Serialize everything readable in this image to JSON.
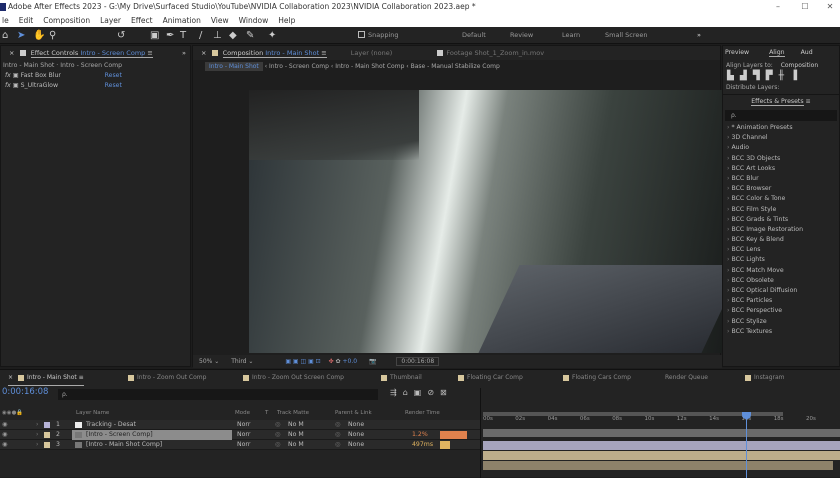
{
  "window": {
    "title": "Adobe After Effects 2023 - G:\\My Drive\\Surfaced Studio\\YouTube\\NVIDIA Collaboration 2023\\NVIDIA Collaboration 2023.aep *",
    "minimize": "–",
    "maximize": "☐",
    "close": "✕"
  },
  "menu": [
    "le",
    "Edit",
    "Composition",
    "Layer",
    "Effect",
    "Animation",
    "View",
    "Window",
    "Help"
  ],
  "toolbar": {
    "snapping": "Snapping",
    "workspaces": [
      "Default",
      "Review",
      "Learn",
      "Small Screen"
    ],
    "more": "»"
  },
  "effect_controls": {
    "title": "Effect Controls",
    "comp": "Intro - Screen Comp",
    "path": "Intro - Main Shot · Intro - Screen Comp",
    "effects": [
      {
        "name": "Fast Box Blur",
        "reset": "Reset"
      },
      {
        "name": "S_UltraGlow",
        "reset": "Reset"
      }
    ]
  },
  "composition": {
    "title": "Composition",
    "comp": "Intro - Main Shot",
    "layer": "Layer  (none)",
    "footage": "Footage  Shot_1_Zoom_in.mov",
    "breadcrumbs": [
      "Intro - Main Shot",
      "Intro - Screen Comp",
      "Intro - Main Shot Comp",
      "Base - Manual Stabilize Comp"
    ],
    "zoom": "50%",
    "resolution": "Third",
    "exposure": "+0.0",
    "timecode": "0:00:16:08"
  },
  "right_panel": {
    "tabs": [
      "Preview",
      "Align",
      "Aud"
    ],
    "align_label": "Align Layers to:",
    "align_value": "Composition",
    "distribute": "Distribute Layers:",
    "effects_title": "Effects & Presets",
    "search_placeholder": "ρ.",
    "presets": [
      "* Animation Presets",
      "3D Channel",
      "Audio",
      "BCC 3D Objects",
      "BCC Art Looks",
      "BCC Blur",
      "BCC Browser",
      "BCC Color & Tone",
      "BCC Film Style",
      "BCC Grads & Tints",
      "BCC Image Restoration",
      "BCC Key & Blend",
      "BCC Lens",
      "BCC Lights",
      "BCC Match Move",
      "BCC Obsolete",
      "BCC Optical Diffusion",
      "BCC Particles",
      "BCC Perspective",
      "BCC Stylize",
      "BCC Textures"
    ]
  },
  "timeline": {
    "tabs": [
      "Intro - Main Shot",
      "Intro - Zoom Out Comp",
      "Intro - Zoom Out Screen Comp",
      "Thumbnail",
      "Floating Car Comp",
      "Floating Cars Comp",
      "Render Queue",
      "Instagram"
    ],
    "timecode": "0:00:16:08",
    "search_placeholder": "ρ.",
    "columns": {
      "name": "Layer Name",
      "mode": "Mode",
      "t": "T",
      "matte": "Track Matte",
      "parent": "Parent & Link",
      "render": "Render Time"
    },
    "layers": [
      {
        "num": "1",
        "name": "Tracking - Desat",
        "mode": "Norr",
        "matte": "No M",
        "parent": "None",
        "render": "",
        "color": "#b7b4d8"
      },
      {
        "num": "2",
        "name": "[Intro - Screen Comp]",
        "mode": "Norr",
        "matte": "No M",
        "parent": "None",
        "render": "1.2%",
        "color": "#d7c79d"
      },
      {
        "num": "3",
        "name": "[Intro - Main Shot Comp]",
        "mode": "Norr",
        "matte": "No M",
        "parent": "None",
        "render": "497ms",
        "color": "#d7c79d"
      }
    ],
    "ticks": [
      "00s",
      "02s",
      "04s",
      "06s",
      "08s",
      "10s",
      "12s",
      "14s",
      "16s",
      "18s",
      "20s"
    ]
  },
  "colors": {
    "accent": "#5f8fd9",
    "render_orange": "#e0814d",
    "render_yellow": "#e1b460"
  }
}
